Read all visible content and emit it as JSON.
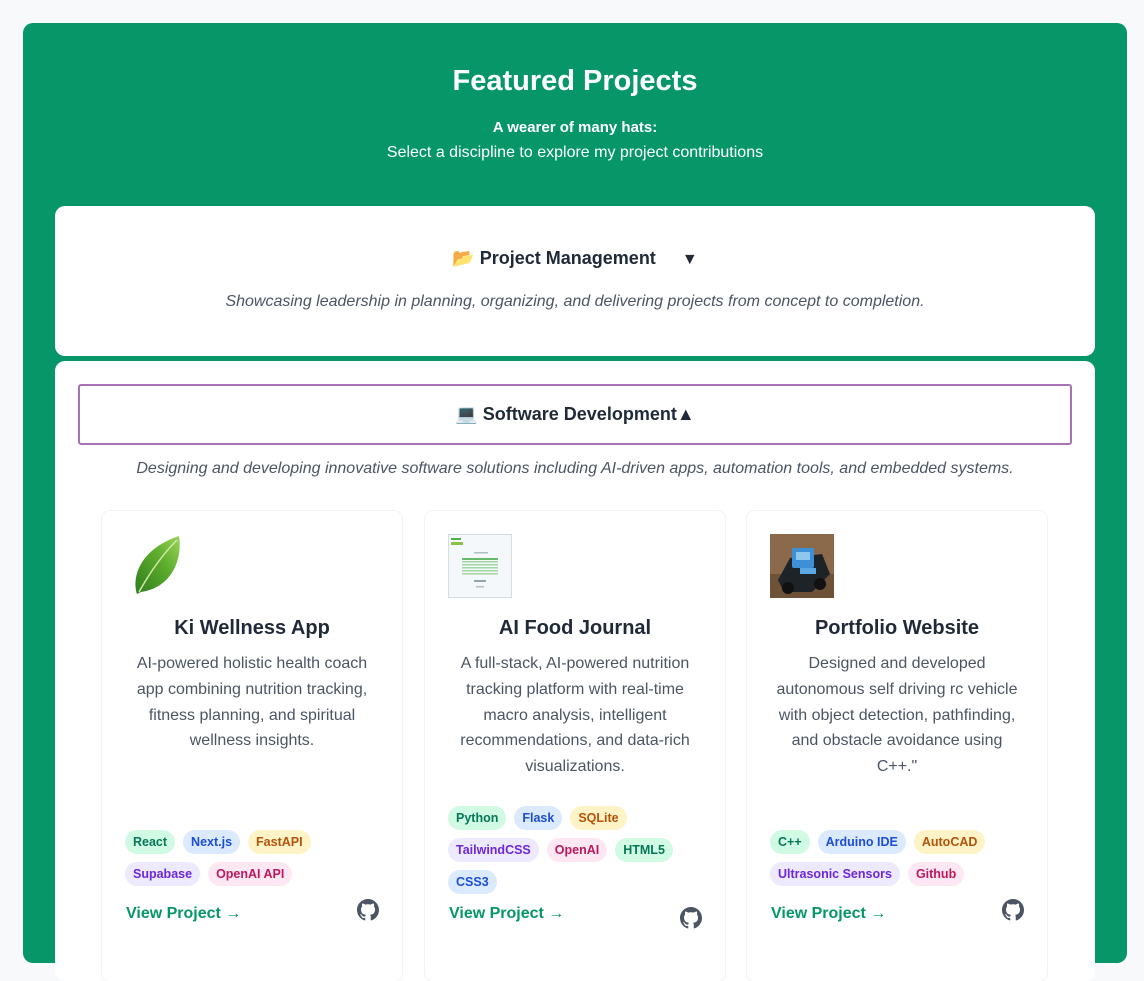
{
  "header": {
    "title": "Featured Projects",
    "subtitle_bold": "A wearer of many hats:",
    "subtitle": "Select a discipline to explore my project contributions"
  },
  "sections": {
    "project_management": {
      "icon": "folder-icon",
      "label": "📂 Project Management",
      "arrow": "▼",
      "description": "Showcasing leadership in planning, organizing, and delivering projects from concept to completion."
    },
    "software_development": {
      "icon": "laptop-icon",
      "label": "💻 Software Development▲",
      "description": "Designing and developing innovative software solutions including AI-driven apps, automation tools, and embedded systems."
    }
  },
  "projects": [
    {
      "name": "Ki Wellness App",
      "description": "AI-powered holistic health coach app combining nutrition tracking, fitness planning, and spiritual wellness insights.",
      "tags": [
        {
          "label": "React",
          "color": "green"
        },
        {
          "label": "Next.js",
          "color": "blue"
        },
        {
          "label": "FastAPI",
          "color": "yellow"
        },
        {
          "label": "Supabase",
          "color": "purple"
        },
        {
          "label": "OpenAI API",
          "color": "pink"
        }
      ],
      "link": "View Project →"
    },
    {
      "name": "AI Food Journal",
      "description": "A full-stack, AI-powered nutrition tracking platform with real-time macro analysis, intelligent recommendations, and data-rich visualizations.",
      "tags": [
        {
          "label": "Python",
          "color": "green"
        },
        {
          "label": "Flask",
          "color": "blue"
        },
        {
          "label": "SQLite",
          "color": "yellow"
        },
        {
          "label": "TailwindCSS",
          "color": "purple"
        },
        {
          "label": "OpenAI",
          "color": "pink"
        },
        {
          "label": "HTML5",
          "color": "green"
        },
        {
          "label": "CSS3",
          "color": "blue"
        }
      ],
      "link": "View Project →"
    },
    {
      "name": "Portfolio Website",
      "description": "Designed and developed autonomous self driving rc vehicle with object detection, pathfinding, and obstacle avoidance using C++.\"",
      "tags": [
        {
          "label": "C++",
          "color": "green"
        },
        {
          "label": "Arduino IDE",
          "color": "blue"
        },
        {
          "label": "AutoCAD",
          "color": "yellow"
        },
        {
          "label": "Ultrasonic Sensors",
          "color": "purple"
        },
        {
          "label": "Github",
          "color": "pink"
        }
      ],
      "link": "View Project →"
    }
  ],
  "colors": {
    "panel_bg": "#069668",
    "accent_green": "#059669",
    "active_border": "#a872b4"
  }
}
